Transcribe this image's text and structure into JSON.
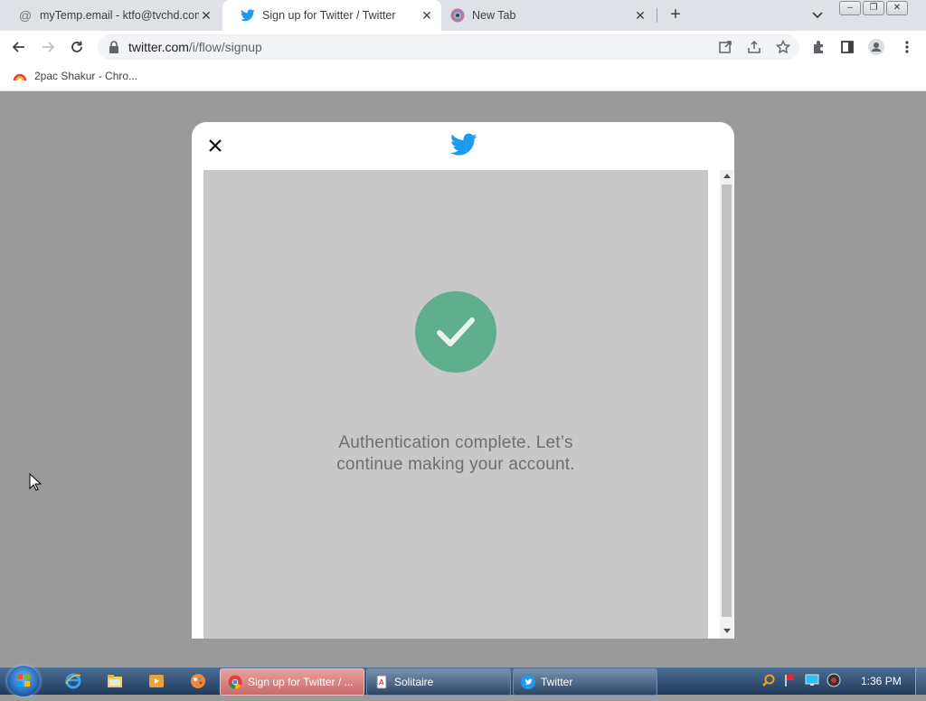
{
  "browser": {
    "tabs": [
      {
        "title": "myTemp.email - ktfo@tvchd.com",
        "favicon": "at-sign-icon",
        "active": false
      },
      {
        "title": "Sign up for Twitter / Twitter",
        "favicon": "twitter-bird-icon",
        "active": true
      },
      {
        "title": "New Tab",
        "favicon": "chrome-avatar-icon",
        "active": false
      }
    ],
    "address_bar": {
      "host": "twitter.com",
      "path": "/i/flow/signup"
    },
    "bookmarks": [
      {
        "label": "2pac Shakur - Chro..."
      }
    ]
  },
  "modal": {
    "message": "Authentication complete. Let’s continue making your account.",
    "accent_color": "#1d9bf0",
    "check_color": "#5fae8d"
  },
  "taskbar": {
    "buttons": [
      {
        "label": "Sign up for Twitter / ...",
        "icon": "chrome-icon",
        "active": true
      },
      {
        "label": "Solitaire",
        "icon": "solitaire-icon",
        "active": false
      },
      {
        "label": "Twitter",
        "icon": "twitter-bird-icon",
        "active": false
      }
    ],
    "clock": "1:36 PM"
  }
}
